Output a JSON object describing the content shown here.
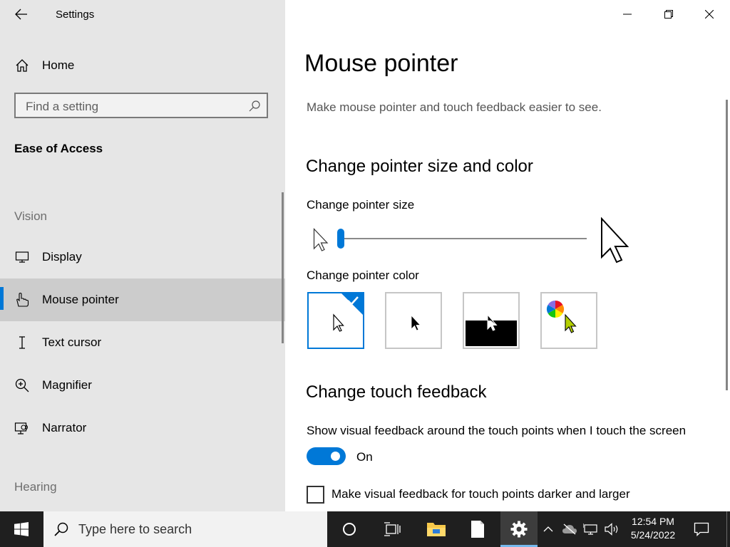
{
  "window": {
    "title": "Settings"
  },
  "sidebar": {
    "home": "Home",
    "search_placeholder": "Find a setting",
    "group": "Ease of Access",
    "vision_heading": "Vision",
    "items": [
      {
        "label": "Display",
        "icon": "monitor-icon"
      },
      {
        "label": "Mouse pointer",
        "icon": "mouse-pointer-hand-icon",
        "selected": true
      },
      {
        "label": "Text cursor",
        "icon": "text-cursor-icon"
      },
      {
        "label": "Magnifier",
        "icon": "magnifier-icon"
      },
      {
        "label": "Narrator",
        "icon": "narrator-icon"
      }
    ],
    "hearing_heading": "Hearing"
  },
  "main": {
    "title": "Mouse pointer",
    "subtitle": "Make mouse pointer and touch feedback easier to see.",
    "pointer_section": "Change pointer size and color",
    "size_label": "Change pointer size",
    "size_value": 1,
    "color_label": "Change pointer color",
    "color_options": [
      {
        "name": "white",
        "selected": true
      },
      {
        "name": "black",
        "selected": false
      },
      {
        "name": "inverted",
        "selected": false
      },
      {
        "name": "custom",
        "selected": false
      }
    ],
    "touch_section": "Change touch feedback",
    "visual_feedback_label": "Show visual feedback around the touch points when I touch the screen",
    "toggle_state": "On",
    "darker_label": "Make visual feedback for touch points darker and larger",
    "darker_checked": false
  },
  "taskbar": {
    "search_placeholder": "Type here to search",
    "time": "12:54 PM",
    "date": "5/24/2022"
  },
  "colors": {
    "accent": "#0078d7",
    "sidebar_bg": "#e6e6e6",
    "taskbar_bg": "#1f1f1f"
  }
}
